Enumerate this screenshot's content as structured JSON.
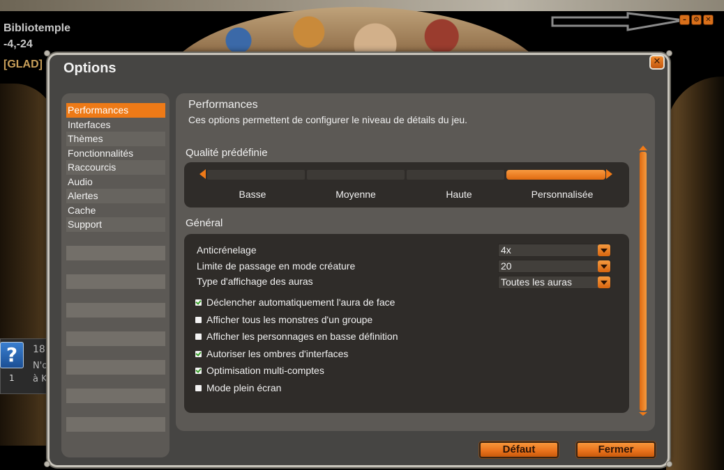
{
  "hud": {
    "map_name": "Bibliotemple",
    "coords": "-4,-24",
    "guild_tag": "[GLAD]",
    "help_glyph": "?",
    "help_count": "1",
    "chat_number": "18",
    "chat_line1": "N'o",
    "chat_line2": "à K"
  },
  "window_controls": {
    "minimize_glyph": "–",
    "settings_glyph": "⚙",
    "close_glyph": "✕"
  },
  "dialog": {
    "title": "Options",
    "close_glyph": "✕",
    "sidebar": {
      "items": [
        {
          "label": "Performances",
          "active": true
        },
        {
          "label": "Interfaces"
        },
        {
          "label": "Thèmes"
        },
        {
          "label": "Fonctionnalités"
        },
        {
          "label": "Raccourcis"
        },
        {
          "label": "Audio"
        },
        {
          "label": "Alertes"
        },
        {
          "label": "Cache"
        },
        {
          "label": "Support"
        }
      ]
    },
    "content": {
      "heading": "Performances",
      "description": "Ces options permettent de configurer le niveau de détails du jeu.",
      "quality": {
        "title": "Qualité prédéfinie",
        "options": [
          "Basse",
          "Moyenne",
          "Haute",
          "Personnalisée"
        ],
        "selected": "Personnalisée"
      },
      "general": {
        "title": "Général",
        "selects": [
          {
            "label": "Anticrénelage",
            "value": "4x"
          },
          {
            "label": "Limite de passage en mode créature",
            "value": "20"
          },
          {
            "label": "Type d'affichage des auras",
            "value": "Toutes les auras"
          }
        ],
        "checkboxes": [
          {
            "label": "Déclencher automatiquement l'aura de face",
            "checked": true
          },
          {
            "label": "Afficher tous les monstres d'un groupe",
            "checked": false
          },
          {
            "label": "Afficher les personnages en basse définition",
            "checked": false
          },
          {
            "label": "Autoriser les ombres d'interfaces",
            "checked": true
          },
          {
            "label": "Optimisation multi-comptes",
            "checked": true
          },
          {
            "label": "Mode plein écran",
            "checked": false
          }
        ]
      }
    },
    "buttons": {
      "default_label": "Défaut",
      "close_label": "Fermer"
    }
  },
  "colors": {
    "accent": "#ee7a17",
    "panel": "#5c5955",
    "window": "#464543",
    "inset": "#2f2c29"
  }
}
